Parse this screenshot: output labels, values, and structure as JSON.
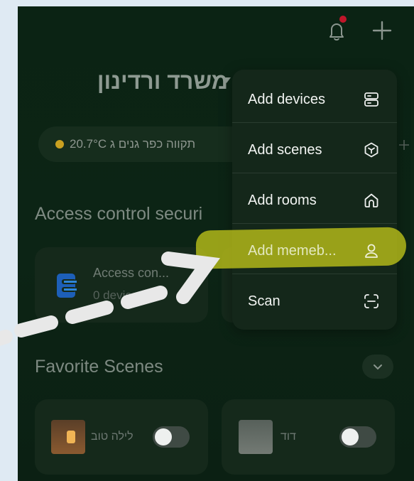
{
  "header": {
    "home_name": "משרד ורדינון",
    "bell_icon": "bell-icon",
    "add_icon": "plus-icon"
  },
  "weather": {
    "text": "20.7°C תקווה כפר גנים ג",
    "status_color": "#c9a020"
  },
  "sections": {
    "access_title": "Access control securi",
    "favorite_title": "Favorite Scenes"
  },
  "device_card": {
    "name": "Access con...",
    "count": "0 devices",
    "icon": "access-control-icon"
  },
  "scenes": [
    {
      "name": "לילה טוב",
      "enabled": false
    },
    {
      "name": "דוד",
      "enabled": false
    }
  ],
  "menu": {
    "items": [
      {
        "label": "Add devices",
        "icon": "devices-icon"
      },
      {
        "label": "Add scenes",
        "icon": "scene-cube-icon"
      },
      {
        "label": "Add rooms",
        "icon": "home-icon"
      },
      {
        "label": "Add memeb...",
        "icon": "person-icon",
        "highlighted": true
      },
      {
        "label": "Scan",
        "icon": "scan-icon"
      }
    ]
  },
  "annotation": {
    "highlight_color": "#bfc41a",
    "arrow_color": "#e8e8e8"
  }
}
